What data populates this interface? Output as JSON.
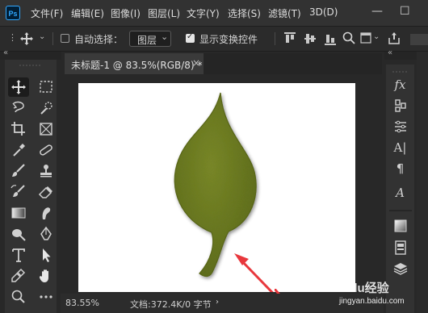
{
  "app": {
    "logo_text": "Ps"
  },
  "menu": {
    "items": [
      "文件(F)",
      "编辑(E)",
      "图像(I)",
      "图层(L)",
      "文字(Y)",
      "选择(S)",
      "滤镜(T)",
      "3D(D)"
    ]
  },
  "window_controls": {
    "minimize": "—",
    "maximize": "☐"
  },
  "options_bar": {
    "auto_select_label": "自动选择：",
    "auto_select_checked": false,
    "layer_select_value": "图层",
    "show_transform_label": "显示变换控件",
    "show_transform_checked": true
  },
  "document": {
    "tab_label": "未标题-1 @ 83.5%(RGB/8) *",
    "close_glyph": "×",
    "canvas_color": "#ffffff",
    "leaf_color": "#6b7a22",
    "arrow_color": "#e8383d"
  },
  "status_bar": {
    "zoom": "83.55%",
    "doc_info": "文档:372.4K/0 字节"
  },
  "watermark": {
    "text": "Baidu经验",
    "sub": "jingyan.baidu.com"
  },
  "tools": [
    "move-tool",
    "marquee-tool",
    "lasso-tool",
    "quick-select-tool",
    "crop-tool",
    "frame-tool",
    "eyedropper-tool",
    "healing-tool",
    "brush-tool",
    "clone-stamp-tool",
    "history-brush-tool",
    "eraser-tool",
    "gradient-tool",
    "smudge-tool",
    "dodge-tool",
    "pen-tool",
    "type-tool",
    "path-select-tool",
    "shape-tool",
    "hand-tool",
    "zoom-tool",
    "more-tools"
  ]
}
